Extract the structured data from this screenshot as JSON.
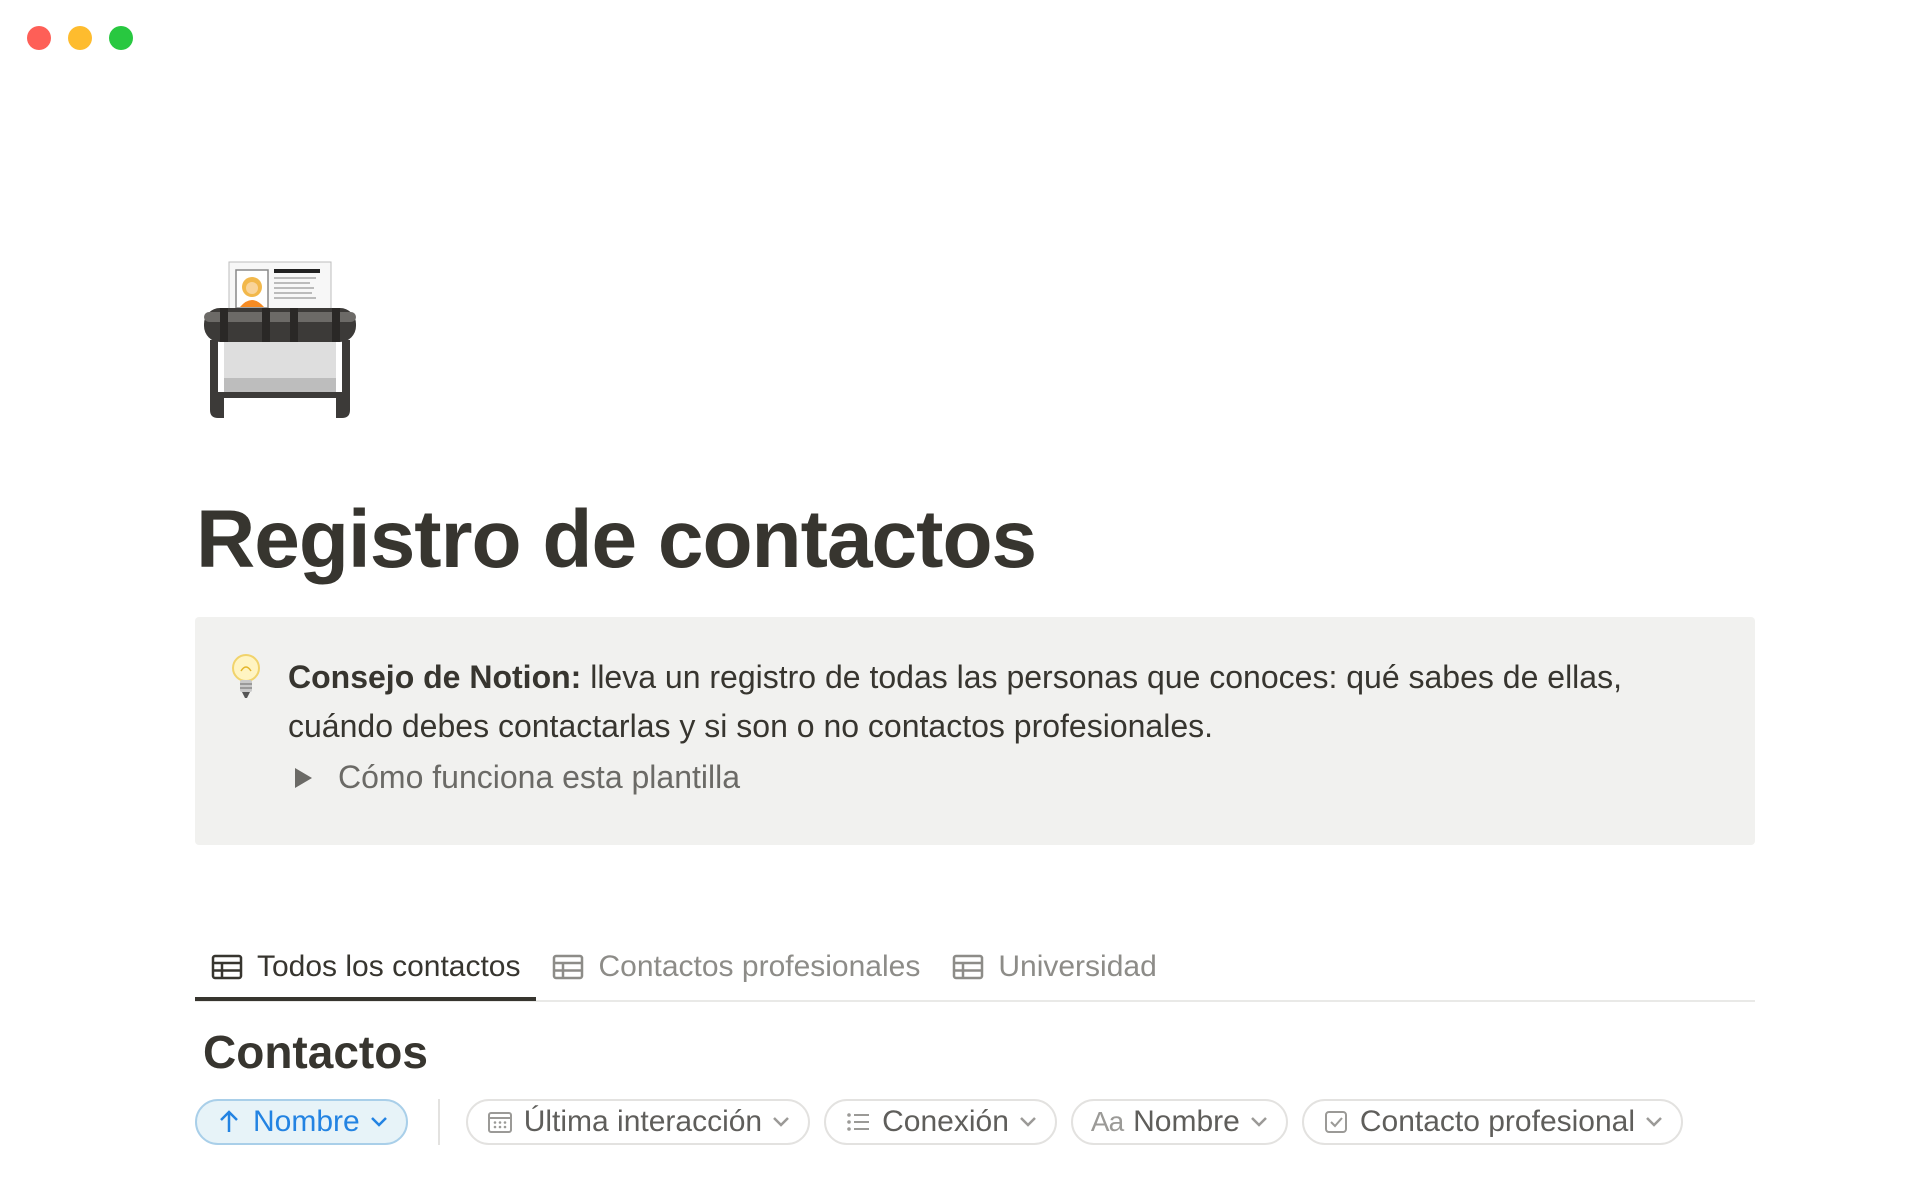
{
  "window": {
    "controls": [
      "close",
      "minimize",
      "zoom"
    ],
    "colors": {
      "close": "#fe5f57",
      "minimize": "#febc2e",
      "zoom": "#28c840"
    }
  },
  "page": {
    "icon": "rolodex-icon",
    "title": "Registro de contactos"
  },
  "callout": {
    "icon": "lightbulb-icon",
    "bold_label": "Consejo de Notion:",
    "text": " lleva un registro de todas las personas que conoces: qué sabes de ellas, cuándo debes contactarlas y si son o no contactos profesionales.",
    "toggle_label": "Cómo funciona esta plantilla"
  },
  "tabs": [
    {
      "label": "Todos los contactos",
      "icon": "table-icon",
      "active": true
    },
    {
      "label": "Contactos profesionales",
      "icon": "table-icon",
      "active": false
    },
    {
      "label": "Universidad",
      "icon": "table-icon",
      "active": false
    }
  ],
  "database": {
    "title": "Contactos"
  },
  "filters": {
    "sort": {
      "label": "Nombre",
      "icon": "arrow-up-icon"
    },
    "properties": [
      {
        "label": "Última interacción",
        "icon": "calendar-icon"
      },
      {
        "label": "Conexión",
        "icon": "list-icon"
      },
      {
        "label": "Nombre",
        "icon": "text-aa-icon",
        "prefix": "Aa"
      },
      {
        "label": "Contacto profesional",
        "icon": "checkbox-icon"
      }
    ]
  },
  "colors": {
    "accent": "#2383e2",
    "text": "#37352f",
    "muted": "#8d8c88",
    "callout_bg": "#f1f1ef"
  }
}
